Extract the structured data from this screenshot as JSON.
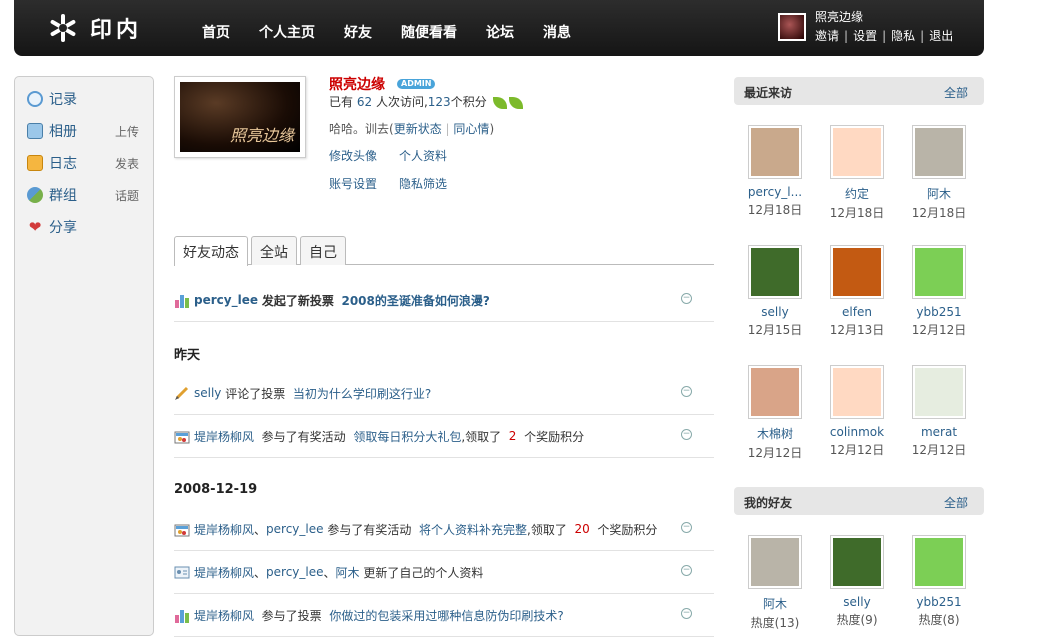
{
  "topbar": {
    "logo_text": "印内",
    "nav": [
      "首页",
      "个人主页",
      "好友",
      "随便看看",
      "论坛",
      "消息"
    ],
    "user_name": "照亮边缘",
    "user_links": [
      "邀请",
      "设置",
      "隐私",
      "退出"
    ]
  },
  "sidebar": {
    "items": [
      {
        "label": "记录",
        "sub": ""
      },
      {
        "label": "相册",
        "sub": "上传"
      },
      {
        "label": "日志",
        "sub": "发表"
      },
      {
        "label": "群组",
        "sub": "话题"
      },
      {
        "label": "分享",
        "sub": ""
      }
    ]
  },
  "profile": {
    "name": "照亮边缘",
    "badge": "ADMIN",
    "photo_caption": "照亮边缘",
    "stats_prefix": "已有",
    "visits": "62",
    "stats_mid": "人次访问,",
    "points": "123",
    "stats_suffix": "个积分",
    "status_text": "哈哈。训去",
    "update_status": "更新状态",
    "same_mood": "同心情",
    "links_row1": [
      "修改头像",
      "个人资料"
    ],
    "links_row2": [
      "账号设置",
      "隐私筛选"
    ]
  },
  "tabs": [
    "好友动态",
    "全站",
    "自己"
  ],
  "feed": {
    "item1": {
      "user": "percy_lee",
      "action": "发起了新投票",
      "target": "2008的圣诞准备如何浪漫?"
    },
    "day1": "昨天",
    "item2": {
      "user": "selly",
      "action": "评论了投票",
      "target": "当初为什么学印刷这行业?"
    },
    "item3": {
      "user": "堤岸杨柳风",
      "action": "参与了有奖活动",
      "target": "领取每日积分大礼包",
      "reward_prefix": ",领取了",
      "reward": "2",
      "reward_suffix": "个奖励积分"
    },
    "day2": "2008-12-19",
    "item4": {
      "user1": "堤岸杨柳风",
      "sep": "、",
      "user2": "percy_lee",
      "action": "参与了有奖活动",
      "target": "将个人资料补充完整",
      "reward_prefix": ",领取了",
      "reward": "20",
      "reward_suffix": "个奖励积分"
    },
    "item5": {
      "user1": "堤岸杨柳风",
      "user2": "percy_lee",
      "user3": "阿木",
      "sep": "、",
      "action": "更新了自己的个人资料"
    },
    "item6": {
      "user": "堤岸杨柳风",
      "action": "参与了投票",
      "target": "你做过的包装采用过哪种信息防伪印刷技术?"
    }
  },
  "recent_visitors": {
    "title": "最近来访",
    "all": "全部",
    "people": [
      {
        "name": "percy_l...",
        "date": "12月18日",
        "color": "#c9a98c"
      },
      {
        "name": "约定",
        "date": "12月18日",
        "color": "#ffd9c2"
      },
      {
        "name": "阿木",
        "date": "12月18日",
        "color": "#b9b4a8"
      },
      {
        "name": "selly",
        "date": "12月15日",
        "color": "#3f6b2a"
      },
      {
        "name": "elfen",
        "date": "12月13日",
        "color": "#c35a12"
      },
      {
        "name": "ybb251",
        "date": "12月12日",
        "color": "#7ccf55"
      },
      {
        "name": "木棉树",
        "date": "12月12日",
        "color": "#d9a488"
      },
      {
        "name": "colinmok",
        "date": "12月12日",
        "color": "#ffd9c2"
      },
      {
        "name": "merat",
        "date": "12月12日",
        "color": "#e6ede0"
      }
    ]
  },
  "my_friends": {
    "title": "我的好友",
    "all": "全部",
    "people": [
      {
        "name": "阿木",
        "heat": "热度(13)",
        "color": "#b9b4a8"
      },
      {
        "name": "selly",
        "heat": "热度(9)",
        "color": "#3f6b2a"
      },
      {
        "name": "ybb251",
        "heat": "热度(8)",
        "color": "#7ccf55"
      }
    ]
  }
}
